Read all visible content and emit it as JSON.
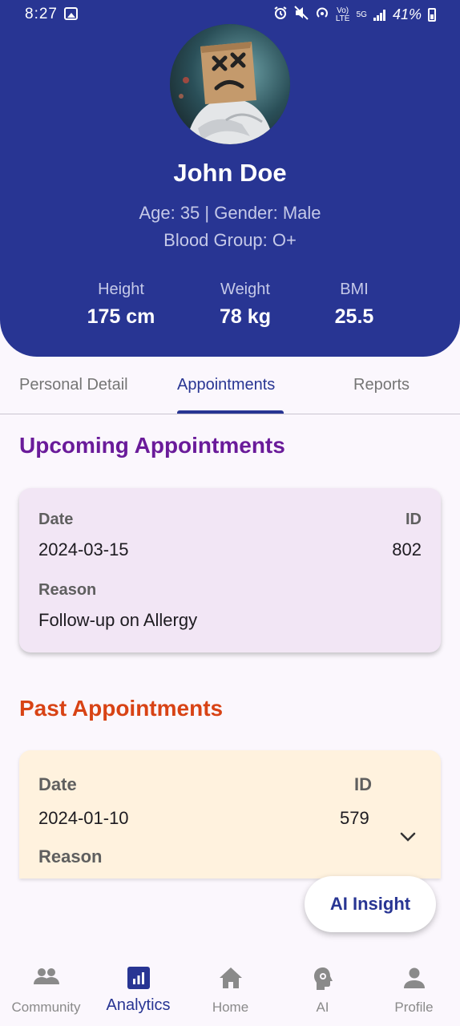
{
  "status_bar": {
    "time": "8:27",
    "network_label": "Vo) LTE",
    "network_5g": "5G",
    "battery": "41%"
  },
  "profile": {
    "name": "John Doe",
    "details_line1": "Age: 35 | Gender: Male",
    "details_line2": "Blood Group: O+",
    "stats": [
      {
        "label": "Height",
        "value": "175 cm"
      },
      {
        "label": "Weight",
        "value": "78 kg"
      },
      {
        "label": "BMI",
        "value": "25.5"
      }
    ]
  },
  "tabs": [
    {
      "label": "Personal Detail"
    },
    {
      "label": "Appointments"
    },
    {
      "label": "Reports"
    }
  ],
  "upcoming": {
    "title": "Upcoming Appointments",
    "date_label": "Date",
    "date": "2024-03-15",
    "id_label": "ID",
    "id": "802",
    "reason_label": "Reason",
    "reason": "Follow-up on Allergy"
  },
  "past": {
    "title": "Past Appointments",
    "date_label": "Date",
    "date": "2024-01-10",
    "id_label": "ID",
    "id": "579",
    "reason_label": "Reason"
  },
  "fab": {
    "label": "AI Insight"
  },
  "nav": [
    {
      "label": "Community",
      "icon": "people-icon"
    },
    {
      "label": "Analytics",
      "icon": "analytics-icon"
    },
    {
      "label": "Home",
      "icon": "home-icon"
    },
    {
      "label": "AI",
      "icon": "ai-head-icon"
    },
    {
      "label": "Profile",
      "icon": "person-icon"
    }
  ],
  "colors": {
    "primary": "#283593",
    "upcoming_title": "#6a1b9a",
    "past_title": "#d84315",
    "upcoming_card": "#f2e6f5",
    "past_card": "#fff2de"
  }
}
